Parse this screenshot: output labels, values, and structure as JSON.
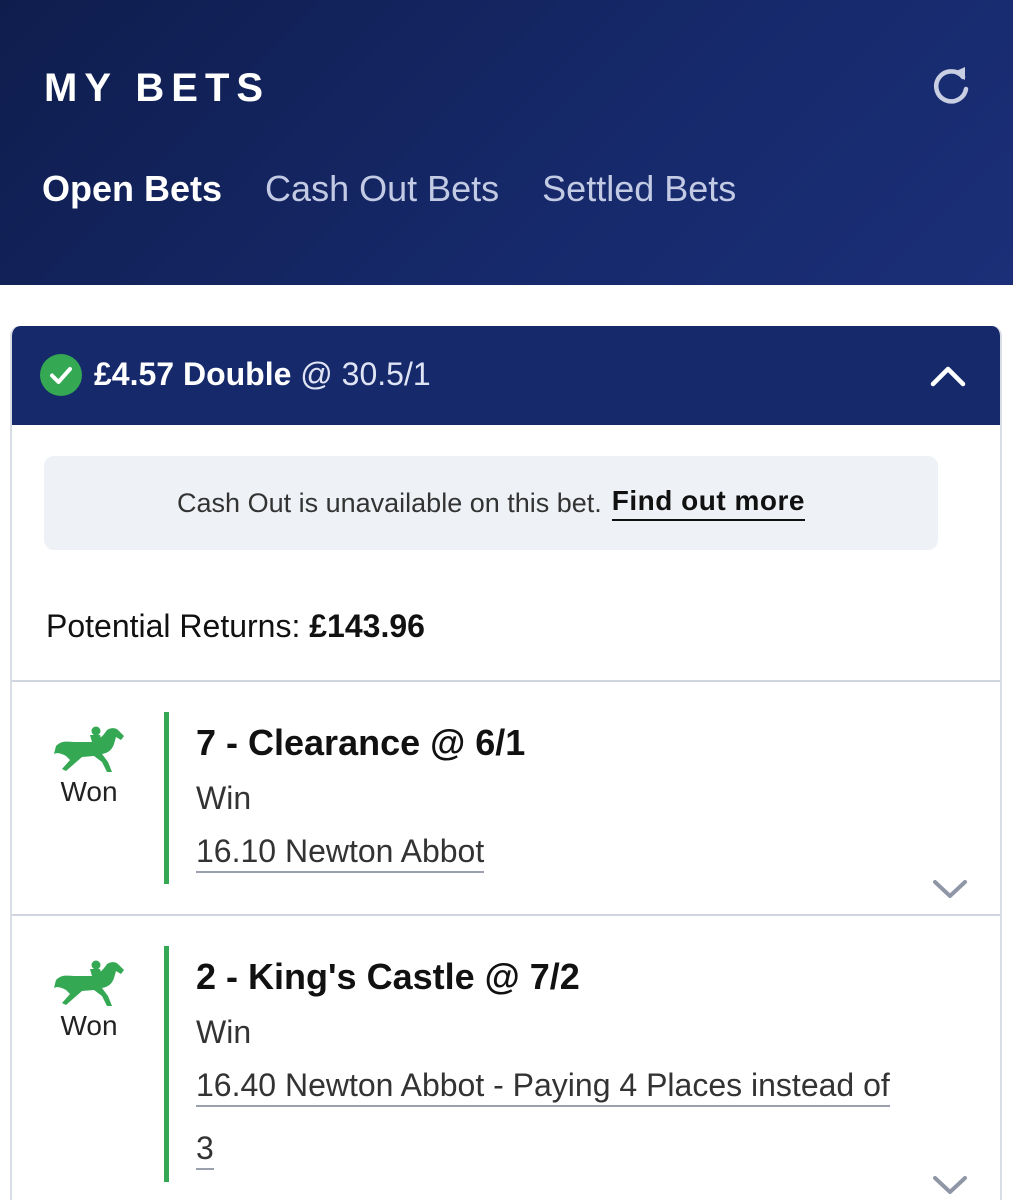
{
  "header": {
    "title": "MY BETS",
    "tabs": [
      "Open Bets",
      "Cash Out Bets",
      "Settled Bets"
    ],
    "active_tab": "Open Bets",
    "refresh_icon": "refresh-icon",
    "colors": {
      "background": "#16296b",
      "active_tab": "#ffffff",
      "inactive_tab": "#c3cae4"
    }
  },
  "bet": {
    "stake": "£4.57",
    "type": "Double",
    "odds": "@ 30.5/1",
    "status_icon": "check-circle-icon",
    "collapse_icon": "chevron-up-icon",
    "cashout_notice": "Cash Out is unavailable on this bet.",
    "cashout_link": "Find out more",
    "returns_label": "Potential Returns:",
    "returns_value": "£143.96",
    "colors": {
      "success": "#34a853",
      "header": "#16296b"
    }
  },
  "selections": [
    {
      "status": "Won",
      "name": "7 - Clearance @ 6/1",
      "market": "Win",
      "event": "16.10 Newton Abbot",
      "icon": "horse-racing-icon"
    },
    {
      "status": "Won",
      "name": "2 - King's Castle @ 7/2",
      "market": "Win",
      "event": "16.40 Newton Abbot - Paying 4 Places instead of 3",
      "icon": "horse-racing-icon"
    }
  ]
}
